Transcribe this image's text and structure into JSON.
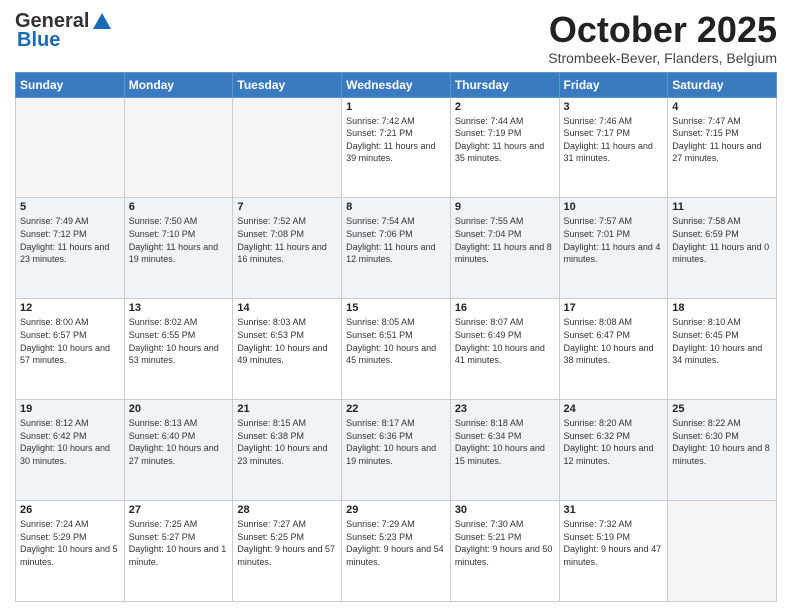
{
  "header": {
    "logo_general": "General",
    "logo_blue": "Blue",
    "month": "October 2025",
    "location": "Strombeek-Bever, Flanders, Belgium"
  },
  "days_of_week": [
    "Sunday",
    "Monday",
    "Tuesday",
    "Wednesday",
    "Thursday",
    "Friday",
    "Saturday"
  ],
  "weeks": [
    [
      {
        "day": "",
        "empty": true
      },
      {
        "day": "",
        "empty": true
      },
      {
        "day": "",
        "empty": true
      },
      {
        "day": "1",
        "sunrise": "7:42 AM",
        "sunset": "7:21 PM",
        "daylight": "11 hours and 39 minutes."
      },
      {
        "day": "2",
        "sunrise": "7:44 AM",
        "sunset": "7:19 PM",
        "daylight": "11 hours and 35 minutes."
      },
      {
        "day": "3",
        "sunrise": "7:46 AM",
        "sunset": "7:17 PM",
        "daylight": "11 hours and 31 minutes."
      },
      {
        "day": "4",
        "sunrise": "7:47 AM",
        "sunset": "7:15 PM",
        "daylight": "11 hours and 27 minutes."
      }
    ],
    [
      {
        "day": "5",
        "sunrise": "7:49 AM",
        "sunset": "7:12 PM",
        "daylight": "11 hours and 23 minutes."
      },
      {
        "day": "6",
        "sunrise": "7:50 AM",
        "sunset": "7:10 PM",
        "daylight": "11 hours and 19 minutes."
      },
      {
        "day": "7",
        "sunrise": "7:52 AM",
        "sunset": "7:08 PM",
        "daylight": "11 hours and 16 minutes."
      },
      {
        "day": "8",
        "sunrise": "7:54 AM",
        "sunset": "7:06 PM",
        "daylight": "11 hours and 12 minutes."
      },
      {
        "day": "9",
        "sunrise": "7:55 AM",
        "sunset": "7:04 PM",
        "daylight": "11 hours and 8 minutes."
      },
      {
        "day": "10",
        "sunrise": "7:57 AM",
        "sunset": "7:01 PM",
        "daylight": "11 hours and 4 minutes."
      },
      {
        "day": "11",
        "sunrise": "7:58 AM",
        "sunset": "6:59 PM",
        "daylight": "11 hours and 0 minutes."
      }
    ],
    [
      {
        "day": "12",
        "sunrise": "8:00 AM",
        "sunset": "6:57 PM",
        "daylight": "10 hours and 57 minutes."
      },
      {
        "day": "13",
        "sunrise": "8:02 AM",
        "sunset": "6:55 PM",
        "daylight": "10 hours and 53 minutes."
      },
      {
        "day": "14",
        "sunrise": "8:03 AM",
        "sunset": "6:53 PM",
        "daylight": "10 hours and 49 minutes."
      },
      {
        "day": "15",
        "sunrise": "8:05 AM",
        "sunset": "6:51 PM",
        "daylight": "10 hours and 45 minutes."
      },
      {
        "day": "16",
        "sunrise": "8:07 AM",
        "sunset": "6:49 PM",
        "daylight": "10 hours and 41 minutes."
      },
      {
        "day": "17",
        "sunrise": "8:08 AM",
        "sunset": "6:47 PM",
        "daylight": "10 hours and 38 minutes."
      },
      {
        "day": "18",
        "sunrise": "8:10 AM",
        "sunset": "6:45 PM",
        "daylight": "10 hours and 34 minutes."
      }
    ],
    [
      {
        "day": "19",
        "sunrise": "8:12 AM",
        "sunset": "6:42 PM",
        "daylight": "10 hours and 30 minutes."
      },
      {
        "day": "20",
        "sunrise": "8:13 AM",
        "sunset": "6:40 PM",
        "daylight": "10 hours and 27 minutes."
      },
      {
        "day": "21",
        "sunrise": "8:15 AM",
        "sunset": "6:38 PM",
        "daylight": "10 hours and 23 minutes."
      },
      {
        "day": "22",
        "sunrise": "8:17 AM",
        "sunset": "6:36 PM",
        "daylight": "10 hours and 19 minutes."
      },
      {
        "day": "23",
        "sunrise": "8:18 AM",
        "sunset": "6:34 PM",
        "daylight": "10 hours and 15 minutes."
      },
      {
        "day": "24",
        "sunrise": "8:20 AM",
        "sunset": "6:32 PM",
        "daylight": "10 hours and 12 minutes."
      },
      {
        "day": "25",
        "sunrise": "8:22 AM",
        "sunset": "6:30 PM",
        "daylight": "10 hours and 8 minutes."
      }
    ],
    [
      {
        "day": "26",
        "sunrise": "7:24 AM",
        "sunset": "5:29 PM",
        "daylight": "10 hours and 5 minutes."
      },
      {
        "day": "27",
        "sunrise": "7:25 AM",
        "sunset": "5:27 PM",
        "daylight": "10 hours and 1 minute."
      },
      {
        "day": "28",
        "sunrise": "7:27 AM",
        "sunset": "5:25 PM",
        "daylight": "9 hours and 57 minutes."
      },
      {
        "day": "29",
        "sunrise": "7:29 AM",
        "sunset": "5:23 PM",
        "daylight": "9 hours and 54 minutes."
      },
      {
        "day": "30",
        "sunrise": "7:30 AM",
        "sunset": "5:21 PM",
        "daylight": "9 hours and 50 minutes."
      },
      {
        "day": "31",
        "sunrise": "7:32 AM",
        "sunset": "5:19 PM",
        "daylight": "9 hours and 47 minutes."
      },
      {
        "day": "",
        "empty": true
      }
    ]
  ]
}
